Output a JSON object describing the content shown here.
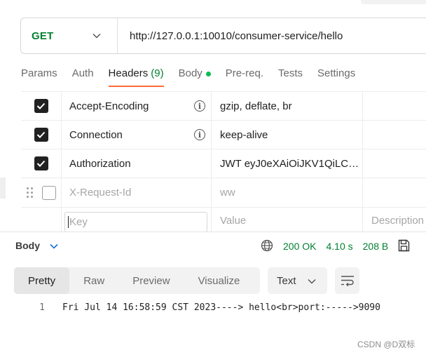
{
  "request": {
    "method": "GET",
    "url": "http://127.0.0.1:10010/consumer-service/hello"
  },
  "tabs": [
    {
      "label": "Params"
    },
    {
      "label": "Auth"
    },
    {
      "label": "Headers",
      "count": "(9)",
      "active": true
    },
    {
      "label": "Body",
      "indicator": "green-dot"
    },
    {
      "label": "Pre-req."
    },
    {
      "label": "Tests"
    },
    {
      "label": "Settings"
    }
  ],
  "headers": {
    "rows": [
      {
        "checked": true,
        "key": "Accept-Encoding",
        "info_icon": "info-icon",
        "value": "gzip, deflate, br",
        "description": ""
      },
      {
        "checked": true,
        "key": "Connection",
        "info_icon": "info-icon",
        "value": "keep-alive",
        "description": ""
      },
      {
        "checked": true,
        "key": "Authorization",
        "value": "JWT eyJ0eXAiOiJKV1QiLC…",
        "description": ""
      },
      {
        "checked": false,
        "key": "X-Request-Id",
        "value": "ww",
        "description": ""
      }
    ],
    "new_row": {
      "key_placeholder": "Key",
      "value_placeholder": "Value",
      "description_placeholder": "Description"
    }
  },
  "response": {
    "title": "Body",
    "status": "200 OK",
    "time": "4.10 s",
    "size": "208 B",
    "view_tabs": [
      "Pretty",
      "Raw",
      "Preview",
      "Visualize"
    ],
    "active_view": "Pretty",
    "format": "Text",
    "lines": [
      {
        "number": "1",
        "text": "Fri Jul 14 16:58:59 CST 2023----> hello<br>port:----->9090"
      }
    ]
  },
  "watermark": "CSDN @D双标",
  "colors": {
    "method": "#007f31",
    "status": "#007f31",
    "active_tab_underline": "#ff6c37",
    "body_dot": "#0cbb52"
  }
}
